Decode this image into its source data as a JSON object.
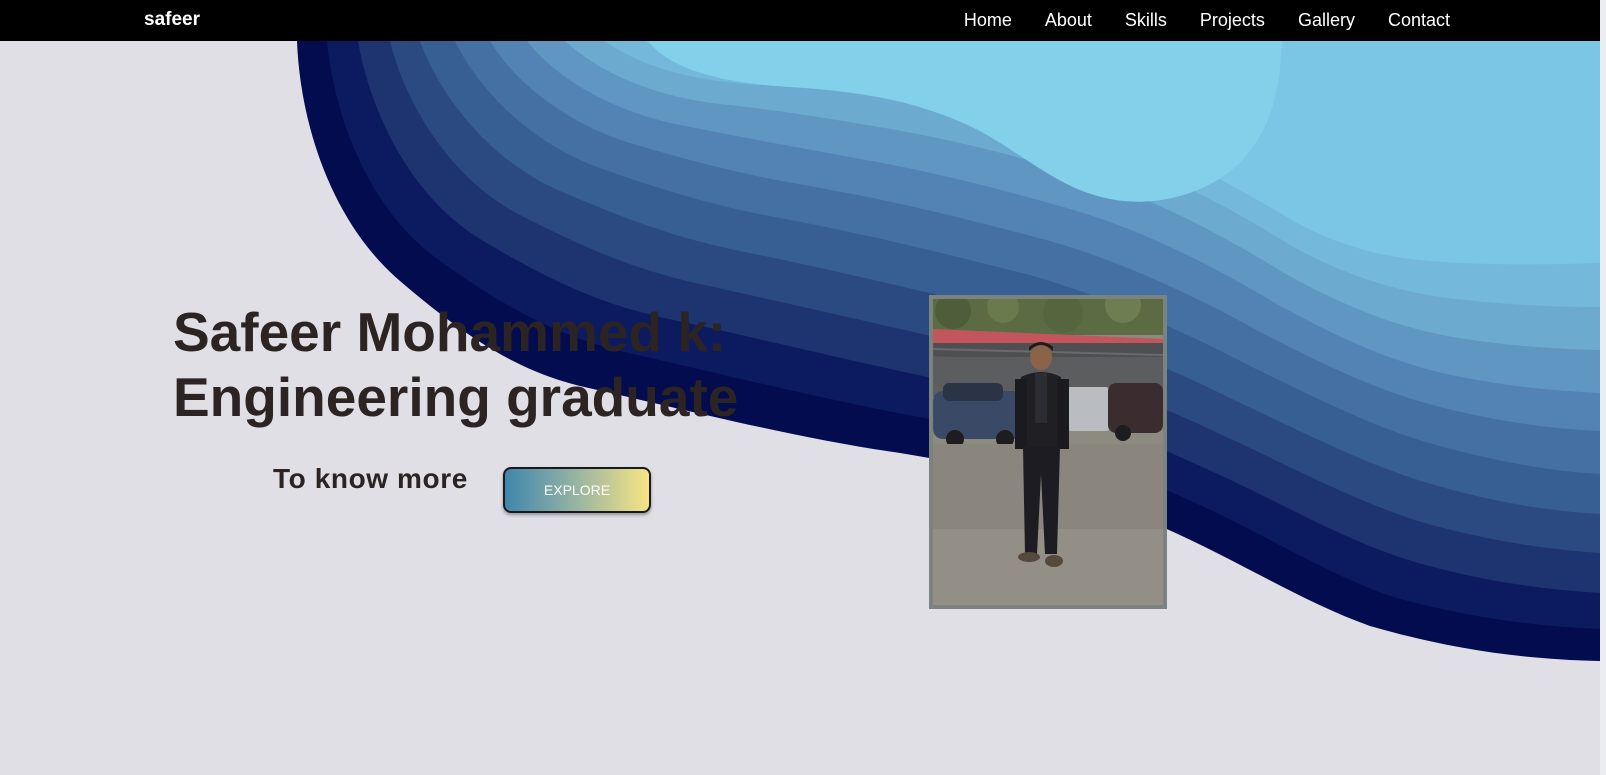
{
  "navbar": {
    "brand": "safeer",
    "links": [
      "Home",
      "About",
      "Skills",
      "Projects",
      "Gallery",
      "Contact"
    ]
  },
  "hero": {
    "title_line1": "Safeer Mohammed k:",
    "title_line2": "Engineering graduate",
    "cta_text": "To know more",
    "explore_label": "EXPLORE"
  },
  "photo": {
    "icon": "portrait-photo"
  },
  "colors": {
    "background": "#dfdfe5",
    "navbar": "#000000",
    "text": "#2b2422",
    "wave_dark": "#020c4f",
    "wave_light": "#82d0ea"
  }
}
